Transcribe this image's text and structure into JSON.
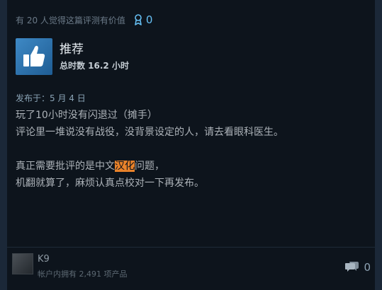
{
  "helpful": {
    "text": "有 20 人觉得这篇评测有价值",
    "award_icon": "award-ribbon-icon",
    "award_count": "0"
  },
  "review": {
    "verdict_icon": "thumbs-up-icon",
    "verdict": "推荐",
    "playtime": "总时数 16.2 小时",
    "posted": "发布于：5 月 4 日",
    "lines": [
      "玩了10小时没有闪退过（摊手）",
      "评论里一堆说没有战役，没背景设定的人，请去看眼科医生。",
      "",
      {
        "before": "真正需要批评的是中文",
        "highlight": "汉化",
        "after": "问题，"
      },
      "机翻就算了，麻烦认真点校对一下再发布。"
    ]
  },
  "author": {
    "avatar_icon": "avatar-image",
    "name": "K9",
    "products": "帐户内拥有 2,491 项产品"
  },
  "comments": {
    "icon": "comment-bubbles-icon",
    "count": "0"
  },
  "colors": {
    "background": "#1b2838",
    "card": "#0d141c",
    "accent": "#66c0f4",
    "highlight": "#e9822a",
    "thumb_blue": "#3e89c5"
  }
}
